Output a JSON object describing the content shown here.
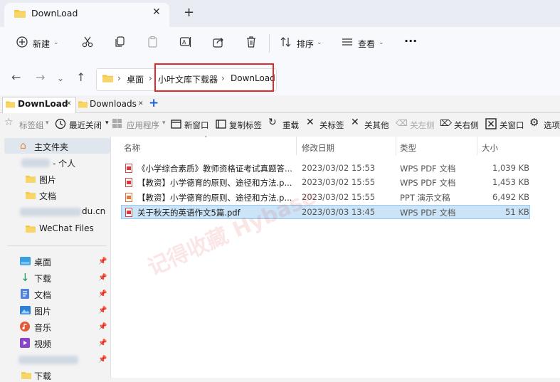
{
  "window": {
    "tab_title": "DownLoad",
    "tab_close": "✕",
    "new_tab": "+"
  },
  "toolbar": {
    "new_label": "新建",
    "sort_label": "排序",
    "view_label": "查看",
    "more": "···"
  },
  "address": {
    "crumbs": [
      "桌面",
      "小叶文库下载器",
      "DownLoad"
    ],
    "sep": "›"
  },
  "tabs2": [
    {
      "label": "DownLoad",
      "close": "✕"
    },
    {
      "label": "Downloads",
      "close": "✕"
    }
  ],
  "tabs2_add": "+",
  "toolbar2": {
    "bookmarks": "标签组",
    "recent": "最近关闭",
    "apps": "应用程序",
    "new_window": "新窗口",
    "copy_tab": "复制标签",
    "reload": "重载",
    "close_tab": "关标签",
    "close_others": "关其他",
    "close_left": "关左侧",
    "close_right": "关右侧",
    "close_window": "关窗口",
    "options": "选项"
  },
  "sidebar": {
    "home": "主文件夹",
    "personal_suffix": "- 个人",
    "pictures": "图片",
    "documents": "文档",
    "account_suffix": "du.cn",
    "wechat": "WeChat Files",
    "quick": [
      {
        "label": "桌面"
      },
      {
        "label": "下载"
      },
      {
        "label": "文档"
      },
      {
        "label": "图片"
      },
      {
        "label": "音乐"
      },
      {
        "label": "视频"
      }
    ],
    "bottom": "下载"
  },
  "list": {
    "headers": {
      "name": "名称",
      "modified": "修改日期",
      "type": "类型",
      "size": "大小"
    },
    "rows": [
      {
        "name": "《小学综合素质》教师资格证考试真题答...",
        "modified": "2023/03/02 15:53",
        "type": "WPS PDF 文档",
        "size": "1,039 KB",
        "icon": "pdf"
      },
      {
        "name": "【教资】小学德育的原则、途径和方法.p...",
        "modified": "2023/03/02 15:55",
        "type": "WPS PDF 文档",
        "size": "1,453 KB",
        "icon": "pdf"
      },
      {
        "name": "【教资】小学德育的原则、途径和方法.p...",
        "modified": "2023/03/02 15:55",
        "type": "PPT 演示文稿",
        "size": "6,492 KB",
        "icon": "ppt"
      },
      {
        "name": "关于秋天的英语作文5篇.pdf",
        "modified": "2023/03/03 13:45",
        "type": "WPS PDF 文档",
        "size": "51 KB",
        "icon": "pdf"
      }
    ]
  },
  "watermark": "记得收藏 Hybase",
  "colors": {
    "accent": "#0067c0",
    "highlight": "#e0292b",
    "selection": "#cce4f7",
    "folder": "#f4c542"
  }
}
